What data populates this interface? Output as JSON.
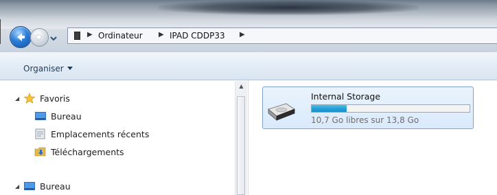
{
  "address": {
    "crumbs": [
      "Ordinateur",
      "IPAD CDDP33"
    ]
  },
  "toolbar": {
    "organise_label": "Organiser"
  },
  "nav": {
    "favorites_label": "Favoris",
    "items": [
      {
        "label": "Bureau",
        "icon": "desktop-icon"
      },
      {
        "label": "Emplacements récents",
        "icon": "recent-places-icon"
      },
      {
        "label": "Téléchargements",
        "icon": "downloads-icon"
      }
    ],
    "desktop_label": "Bureau"
  },
  "drive": {
    "name": "Internal Storage",
    "free_text": "10,7 Go libres sur 13,8 Go",
    "used_fraction": 0.22,
    "icon": "drive-icon"
  },
  "colors": {
    "accent": "#26a0da",
    "tile_border": "#7da2ce"
  }
}
